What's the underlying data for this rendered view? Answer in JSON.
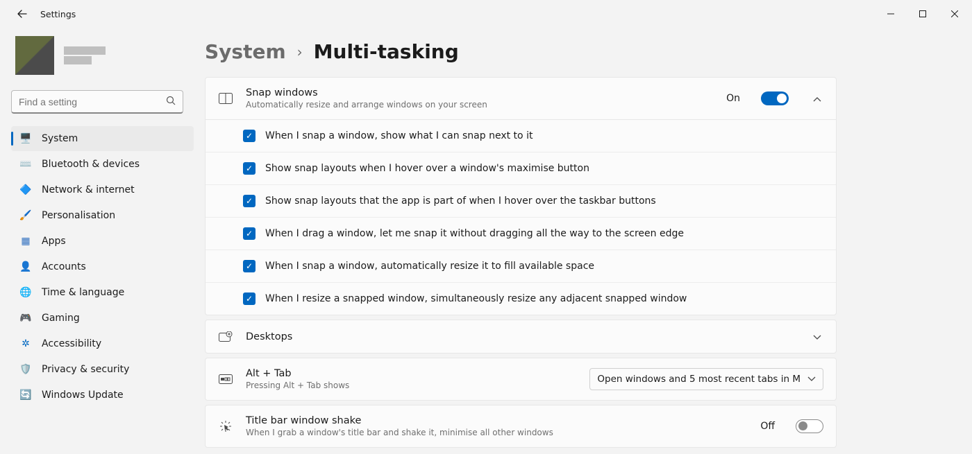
{
  "titlebar": {
    "title": "Settings"
  },
  "search": {
    "placeholder": "Find a setting"
  },
  "nav": {
    "items": [
      {
        "label": "System",
        "icon": "🖥️",
        "color": "#0067c0"
      },
      {
        "label": "Bluetooth & devices",
        "icon": "⌨️",
        "color": "#0067c0"
      },
      {
        "label": "Network & internet",
        "icon": "🔷",
        "color": "#0067c0"
      },
      {
        "label": "Personalisation",
        "icon": "🖌️",
        "color": "#c96a2f"
      },
      {
        "label": "Apps",
        "icon": "▦",
        "color": "#2f6fbf"
      },
      {
        "label": "Accounts",
        "icon": "👤",
        "color": "#2f8f5b"
      },
      {
        "label": "Time & language",
        "icon": "🌐",
        "color": "#2f6fbf"
      },
      {
        "label": "Gaming",
        "icon": "🎮",
        "color": "#6b6b6b"
      },
      {
        "label": "Accessibility",
        "icon": "✲",
        "color": "#0067c0"
      },
      {
        "label": "Privacy & security",
        "icon": "🛡️",
        "color": "#6b6b6b"
      },
      {
        "label": "Windows Update",
        "icon": "🔄",
        "color": "#0067c0"
      }
    ],
    "active_index": 0
  },
  "breadcrumb": {
    "root": "System",
    "page": "Multi-tasking"
  },
  "snap": {
    "title": "Snap windows",
    "desc": "Automatically resize and arrange windows on your screen",
    "state": "On",
    "options": [
      "When I snap a window, show what I can snap next to it",
      "Show snap layouts when I hover over a window's maximise button",
      "Show snap layouts that the app is part of when I hover over the taskbar buttons",
      "When I drag a window, let me snap it without dragging all the way to the screen edge",
      "When I snap a window, automatically resize it to fill available space",
      "When I resize a snapped window, simultaneously resize any adjacent snapped window"
    ]
  },
  "desktops": {
    "title": "Desktops"
  },
  "alttab": {
    "title": "Alt + Tab",
    "desc": "Pressing Alt + Tab shows",
    "selected": "Open windows and 5 most recent tabs in M"
  },
  "shake": {
    "title": "Title bar window shake",
    "desc": "When I grab a window's title bar and shake it, minimise all other windows",
    "state": "Off"
  }
}
